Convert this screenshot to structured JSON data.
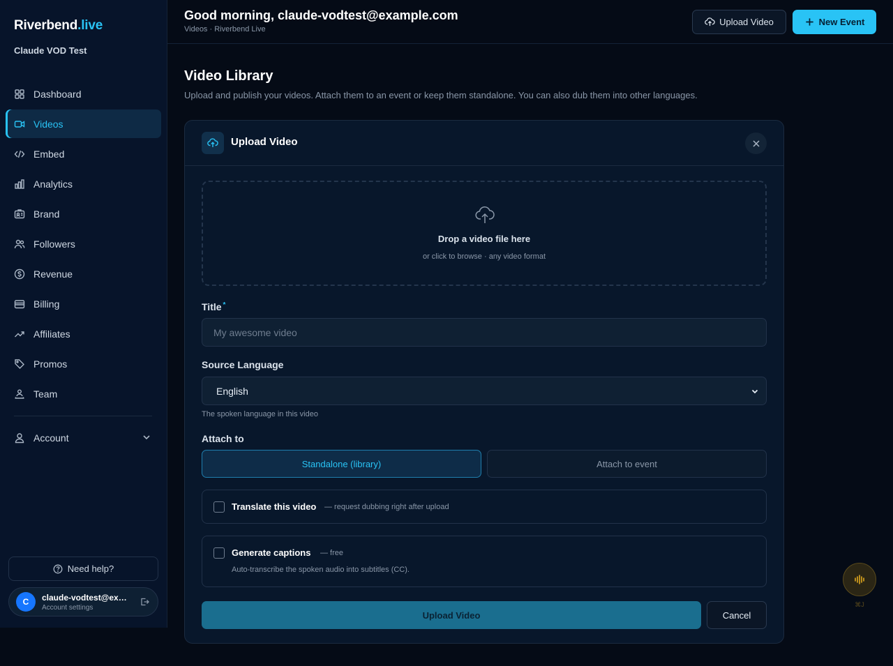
{
  "brand": {
    "name": "Riverbend",
    "tld": ".live",
    "org": "Claude VOD Test"
  },
  "nav": {
    "items": [
      {
        "label": "Dashboard",
        "icon": "grid-icon",
        "active": false
      },
      {
        "label": "Videos",
        "icon": "video-icon",
        "active": true
      },
      {
        "label": "Embed",
        "icon": "code-icon",
        "active": false
      },
      {
        "label": "Analytics",
        "icon": "bar-chart-icon",
        "active": false
      },
      {
        "label": "Brand",
        "icon": "id-card-icon",
        "active": false
      },
      {
        "label": "Followers",
        "icon": "users-icon",
        "active": false
      },
      {
        "label": "Revenue",
        "icon": "dollar-circle-icon",
        "active": false
      },
      {
        "label": "Billing",
        "icon": "wallet-icon",
        "active": false
      },
      {
        "label": "Affiliates",
        "icon": "trending-up-icon",
        "active": false
      },
      {
        "label": "Promos",
        "icon": "tag-icon",
        "active": false
      },
      {
        "label": "Team",
        "icon": "team-icon",
        "active": false
      }
    ],
    "account": "Account"
  },
  "help": {
    "label": "Need help?"
  },
  "user": {
    "initial": "C",
    "name": "claude-vodtest@ex…",
    "sub": "Account settings"
  },
  "header": {
    "greeting": "Good morning, claude-vodtest@example.com",
    "breadcrumb": "Videos · Riverbend Live",
    "upload_label": "Upload Video",
    "new_event_label": "New Event"
  },
  "page": {
    "title": "Video Library",
    "description": "Upload and publish your videos. Attach them to an event or keep them standalone. You can also dub them into other languages."
  },
  "panel": {
    "title": "Upload Video",
    "dropzone": {
      "title": "Drop a video file here",
      "subtitle": "or click to browse · any video format"
    },
    "title_field": {
      "label": "Title",
      "required_mark": "*",
      "placeholder": "My awesome video",
      "value": ""
    },
    "language": {
      "label": "Source Language",
      "value": "English",
      "hint": "The spoken language in this video"
    },
    "attach": {
      "label": "Attach to",
      "options": [
        "Standalone (library)",
        "Attach to event"
      ],
      "selected": "Standalone (library)"
    },
    "translate": {
      "title": "Translate this video",
      "note": "— request dubbing right after upload",
      "checked": false
    },
    "captions": {
      "title": "Generate captions",
      "note": "— free",
      "description": "Auto-transcribe the spoken audio into subtitles (CC).",
      "checked": false
    },
    "submit_label": "Upload Video",
    "cancel_label": "Cancel"
  },
  "assistant": {
    "shortcut": "⌘J",
    "accent": "#e0a81e"
  },
  "colors": {
    "accent": "#29c3f5",
    "background": "#050b16",
    "sidebar": "#07142a",
    "panel": "#08172b"
  }
}
